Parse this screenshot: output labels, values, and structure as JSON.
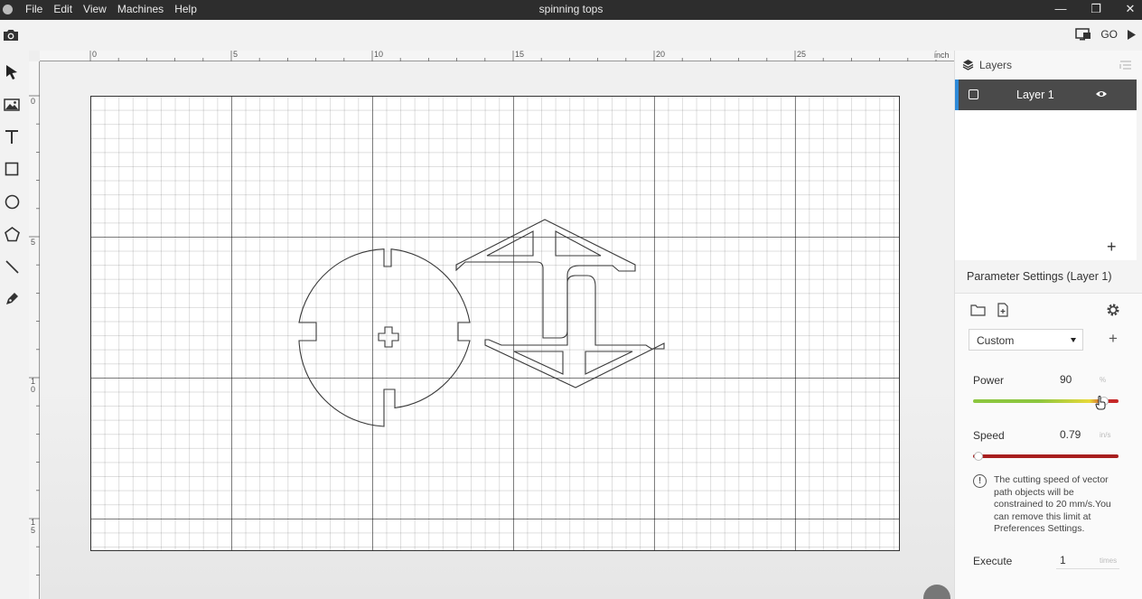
{
  "window": {
    "title": "spinning tops",
    "menu": [
      "File",
      "Edit",
      "View",
      "Machines",
      "Help"
    ],
    "controls": {
      "minimize": "—",
      "restore": "❐",
      "close": "✕"
    }
  },
  "toolbar": {
    "go_label": "GO",
    "icons": [
      "camera-icon",
      "monitor-icon",
      "play-icon"
    ]
  },
  "left_tools": [
    "select-tool",
    "image-tool",
    "text-tool",
    "rectangle-tool",
    "ellipse-tool",
    "polygon-tool",
    "line-tool",
    "pen-tool"
  ],
  "ruler": {
    "top_labels": [
      "0",
      "5",
      "10",
      "15",
      "20",
      "25"
    ],
    "unit": "inch",
    "left_labels": [
      "0",
      "5",
      "1\n0",
      "1\n5"
    ]
  },
  "layers": {
    "header": "Layers",
    "items": [
      {
        "name": "Layer 1",
        "visible": true
      }
    ],
    "add_label": "+"
  },
  "params": {
    "title": "Parameter Settings (Layer 1)",
    "preset": "Custom",
    "add_label": "+",
    "power": {
      "label": "Power",
      "value": "90",
      "unit": "%",
      "level": 0.9
    },
    "speed": {
      "label": "Speed",
      "value": "0.79",
      "unit": "in/s",
      "level": 0.04
    },
    "note": "The cutting speed of vector path objects will be constrained to 20 mm/s.You can remove this limit at Preferences Settings.",
    "info_mark": "!",
    "execute": {
      "label": "Execute",
      "value": "1",
      "unit": "times"
    }
  },
  "colors": {
    "titlebar": "#2d2d2d",
    "selected_layer": "#4a4a4a",
    "layer_accent": "#2e8ad8",
    "power_gradient": [
      "#8cc63f",
      "#e8d93a",
      "#c62828"
    ],
    "speed_track": "#a81f1f"
  }
}
